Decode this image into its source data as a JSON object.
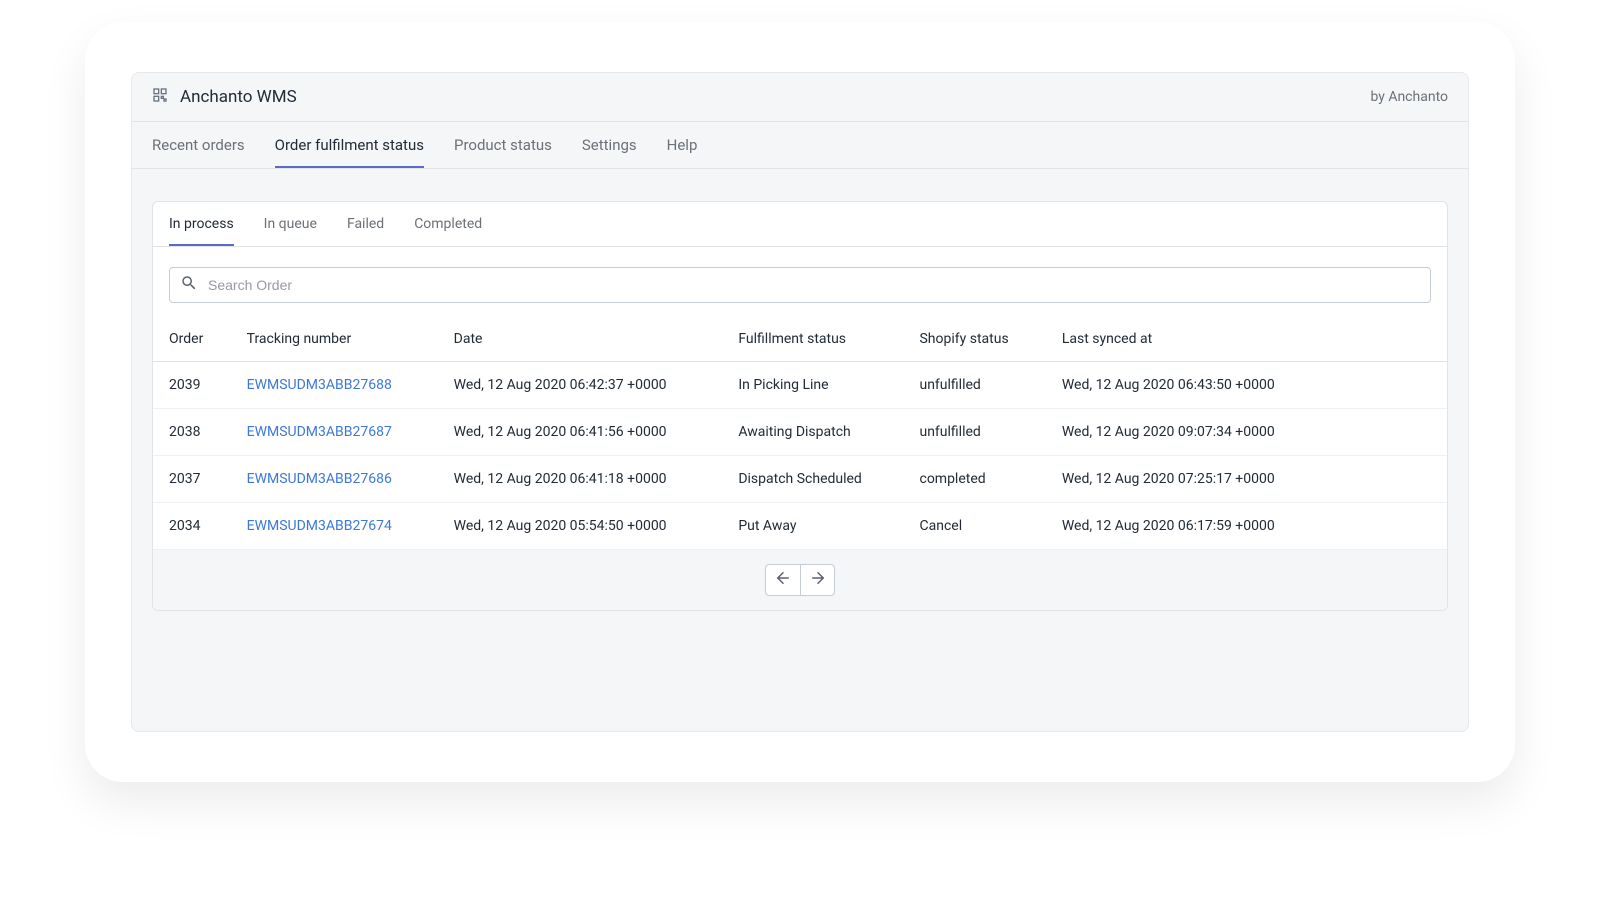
{
  "header": {
    "app_title": "Anchanto WMS",
    "by_text": "by Anchanto"
  },
  "tabs": [
    {
      "label": "Recent orders",
      "active": false
    },
    {
      "label": "Order fulfilment status",
      "active": true
    },
    {
      "label": "Product status",
      "active": false
    },
    {
      "label": "Settings",
      "active": false
    },
    {
      "label": "Help",
      "active": false
    }
  ],
  "subtabs": [
    {
      "label": "In process",
      "active": true
    },
    {
      "label": "In queue",
      "active": false
    },
    {
      "label": "Failed",
      "active": false
    },
    {
      "label": "Completed",
      "active": false
    }
  ],
  "search": {
    "placeholder": "Search Order",
    "value": ""
  },
  "columns": {
    "order": "Order",
    "tracking": "Tracking number",
    "date": "Date",
    "fulfillment": "Fulfillment status",
    "shopify": "Shopify status",
    "synced": "Last synced at"
  },
  "rows": [
    {
      "order": "2039",
      "tracking": "EWMSUDM3ABB27688",
      "date": "Wed, 12 Aug 2020 06:42:37 +0000",
      "fulfillment": "In Picking Line",
      "shopify": "unfulfilled",
      "synced": "Wed, 12 Aug 2020 06:43:50 +0000"
    },
    {
      "order": "2038",
      "tracking": "EWMSUDM3ABB27687",
      "date": "Wed, 12 Aug 2020 06:41:56 +0000",
      "fulfillment": "Awaiting Dispatch",
      "shopify": "unfulfilled",
      "synced": "Wed, 12 Aug 2020 09:07:34 +0000"
    },
    {
      "order": "2037",
      "tracking": "EWMSUDM3ABB27686",
      "date": "Wed, 12 Aug 2020 06:41:18 +0000",
      "fulfillment": "Dispatch Scheduled",
      "shopify": "completed",
      "synced": "Wed, 12 Aug 2020 07:25:17 +0000"
    },
    {
      "order": "2034",
      "tracking": "EWMSUDM3ABB27674",
      "date": "Wed, 12 Aug 2020 05:54:50 +0000",
      "fulfillment": "Put Away",
      "shopify": "Cancel",
      "synced": "Wed, 12 Aug 2020 06:17:59 +0000"
    }
  ]
}
